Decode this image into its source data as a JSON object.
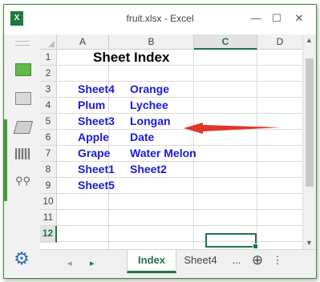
{
  "window": {
    "title": "fruit.xlsx - Excel",
    "logo_text": "X",
    "minimize_glyph": "—",
    "maximize_glyph": "☐",
    "close_glyph": "✕"
  },
  "columns": [
    "A",
    "B",
    "C",
    "D"
  ],
  "active_column": "C",
  "rows": [
    "1",
    "2",
    "3",
    "4",
    "5",
    "6",
    "7",
    "8",
    "9",
    "10",
    "11",
    "12"
  ],
  "active_row": "12",
  "cells": {
    "title": "Sheet Index",
    "A3": "Sheet4",
    "B3": "Orange",
    "A4": "Plum",
    "B4": "Lychee",
    "A5": "Sheet3",
    "B5": "Longan",
    "A6": "Apple",
    "B6": "Date",
    "A7": "Grape",
    "B7": "Water Melon",
    "A8": "Sheet1",
    "B8": "Sheet2",
    "A9": "Sheet5"
  },
  "tabs": {
    "nav_prev": "◂",
    "nav_next": "▸",
    "items": [
      "Index",
      "Sheet4"
    ],
    "active": "Index",
    "more": "...",
    "add": "⊕",
    "options": "⋮"
  },
  "colors": {
    "excel_green": "#217346",
    "link_blue": "#1a1ad6",
    "arrow_red": "#e0352b"
  },
  "icons": [
    "excel-logo-icon",
    "settings-gear-icon",
    "pane-icon",
    "format-icon",
    "stack-icon",
    "columns-icon",
    "binoculars-icon"
  ]
}
